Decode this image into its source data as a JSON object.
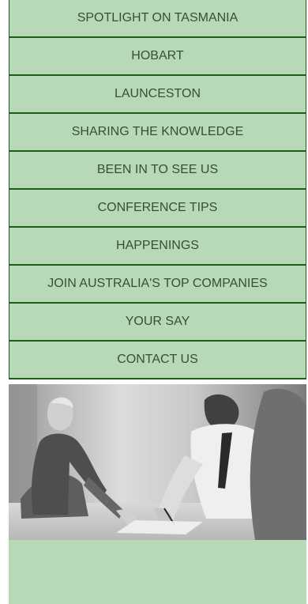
{
  "nav": {
    "items": [
      {
        "label": "SPOTLIGHT ON TASMANIA"
      },
      {
        "label": "HOBART"
      },
      {
        "label": "LAUNCESTON"
      },
      {
        "label": "SHARING THE KNOWLEDGE"
      },
      {
        "label": "BEEN IN TO SEE US"
      },
      {
        "label": "CONFERENCE TIPS"
      },
      {
        "label": "HAPPENINGS"
      },
      {
        "label": "JOIN AUSTRALIA'S TOP COMPANIES"
      },
      {
        "label": "YOUR SAY"
      },
      {
        "label": "CONTACT US"
      }
    ]
  },
  "colors": {
    "nav_background": "#b8d9b8",
    "nav_border": "#1c5c1c",
    "nav_text": "#345034",
    "footer_background": "#b8d9b8"
  },
  "photo": {
    "icon": "people-meeting-photo"
  }
}
